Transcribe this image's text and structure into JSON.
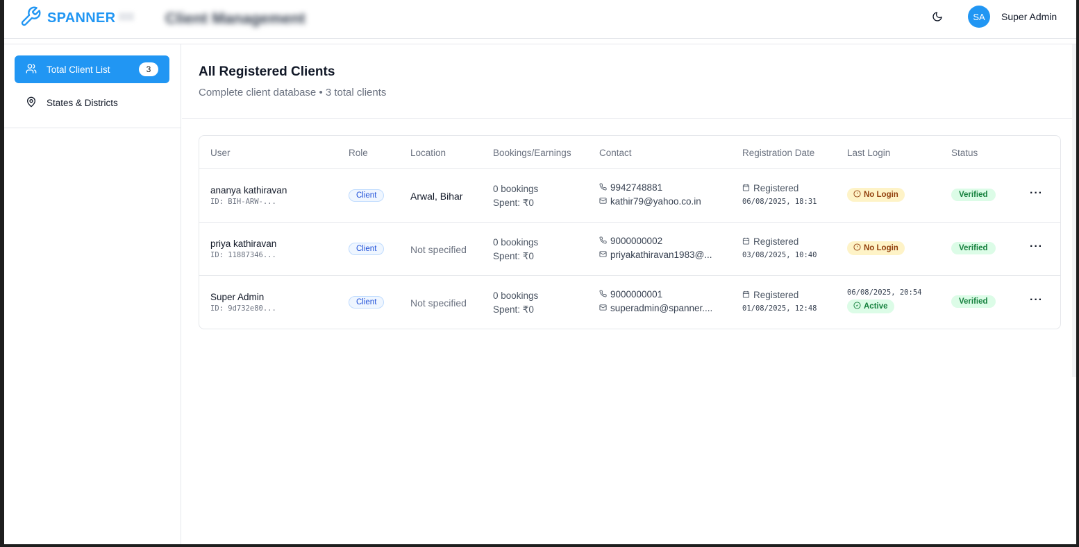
{
  "header": {
    "brand": "SPANNER",
    "page_title": "Client Management",
    "avatar_initials": "SA",
    "user_name": "Super Admin"
  },
  "sidebar": {
    "items": [
      {
        "label": "Total Client List",
        "badge": "3",
        "icon": "users-icon",
        "active": true
      },
      {
        "label": "States & Districts",
        "icon": "map-pin-icon",
        "active": false
      }
    ]
  },
  "main": {
    "title": "All Registered Clients",
    "subtitle": "Complete client database • 3 total clients"
  },
  "table": {
    "columns": [
      "User",
      "Role",
      "Location",
      "Bookings/Earnings",
      "Contact",
      "Registration Date",
      "Last Login",
      "Status"
    ],
    "rows": [
      {
        "name": "ananya kathiravan",
        "id": "ID: BIH-ARW-...",
        "role": "Client",
        "location": "Arwal, Bihar",
        "bookings": "0 bookings",
        "spent": "Spent: ₹0",
        "phone": "9942748881",
        "email": "kathir79@yahoo.co.in",
        "reg_label": "Registered",
        "reg_date": "06/08/2025, 18:31",
        "last_login_date": "",
        "last_login": "No Login",
        "status": "Verified"
      },
      {
        "name": "priya kathiravan",
        "id": "ID: 11887346...",
        "role": "Client",
        "location": "Not specified",
        "bookings": "0 bookings",
        "spent": "Spent: ₹0",
        "phone": "9000000002",
        "email": "priyakathiravan1983@...",
        "reg_label": "Registered",
        "reg_date": "03/08/2025, 10:40",
        "last_login_date": "",
        "last_login": "No Login",
        "status": "Verified"
      },
      {
        "name": "Super Admin",
        "id": "ID: 9d732e80...",
        "role": "Client",
        "location": "Not specified",
        "bookings": "0 bookings",
        "spent": "Spent: ₹0",
        "phone": "9000000001",
        "email": "superadmin@spanner....",
        "reg_label": "Registered",
        "reg_date": "01/08/2025, 12:48",
        "last_login_date": "06/08/2025, 20:54",
        "last_login": "Active",
        "status": "Verified"
      }
    ]
  },
  "colors": {
    "accent": "#2196f3",
    "no_login_bg": "#fef3c7",
    "verified_bg": "#dcfce7"
  }
}
